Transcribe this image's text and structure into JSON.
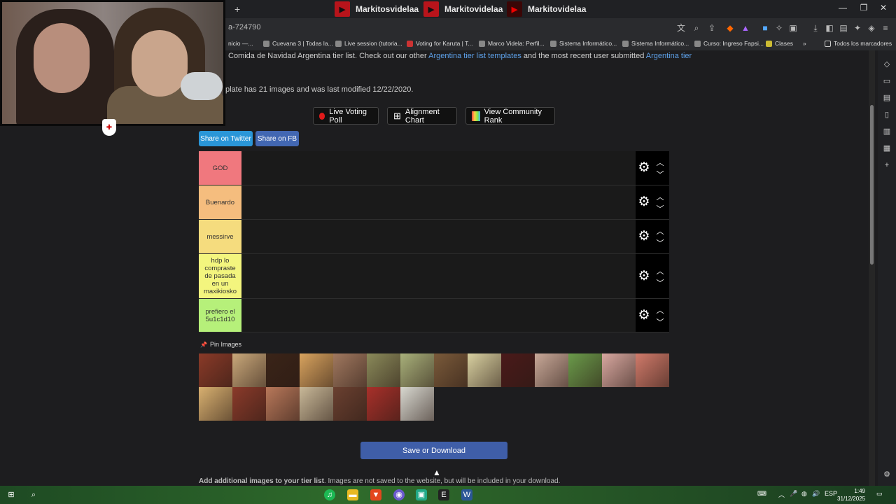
{
  "browser": {
    "tabs": [
      {
        "label": "Markitosvidelaa",
        "icon": "youtube-icon"
      },
      {
        "label": "Markitovidelaa",
        "icon": "youtube-icon"
      },
      {
        "label": "Markitovidelaa",
        "icon": "youtube-icon"
      }
    ],
    "new_tab_label": "+",
    "url": "a-724790",
    "bookmarks": [
      {
        "label": "nicio —..."
      },
      {
        "label": "Cuevana 3 | Todas la..."
      },
      {
        "label": "Live session (tutoria..."
      },
      {
        "label": "Voting for Karuta | T..."
      },
      {
        "label": "Marco Videla: Perfil..."
      },
      {
        "label": "Sistema Informático..."
      },
      {
        "label": "Sistema Informático..."
      },
      {
        "label": "Curso: Ingreso Fapsi..."
      },
      {
        "label": "Clases"
      }
    ],
    "bookmarks_more": "»",
    "all_bookmarks": "Todos los marcadores"
  },
  "page": {
    "intro_prefix": "Comida de Navidad Argentina tier list. Check out our other ",
    "intro_link1": "Argentina tier list templates",
    "intro_mid": " and the most recent user submitted ",
    "intro_link2": "Argentina tier",
    "template_info": "plate has 21 images and was last modified 12/22/2020.",
    "buttons": {
      "live_poll": "Live Voting Poll",
      "alignment": "Alignment Chart",
      "community": "View Community Rank"
    },
    "share_twitter": "Share on Twitter",
    "share_fb": "Share on FB",
    "tiers": [
      {
        "label": "GOD",
        "color": "#f0787e"
      },
      {
        "label": "Buenardo",
        "color": "#f5bd7e"
      },
      {
        "label": "messirve",
        "color": "#f5dc7e"
      },
      {
        "label": "hdp lo compraste de pasada en un maxikiosko",
        "color": "#f3f57e"
      },
      {
        "label": "prefiero el 5u1c1d10",
        "color": "#b6f07a"
      }
    ],
    "pin_label": "Pin Images",
    "images": [
      {
        "color": "#8a3a28"
      },
      {
        "color": "#c9a87a"
      },
      {
        "color": "#3a2418"
      },
      {
        "color": "#d8a35e"
      },
      {
        "color": "#a0785f"
      },
      {
        "color": "#8a8a5a"
      },
      {
        "color": "#a8b07a"
      },
      {
        "color": "#7a5a3a"
      },
      {
        "color": "#d8d0a0"
      },
      {
        "color": "#4a1a1a"
      },
      {
        "color": "#c8a898"
      },
      {
        "color": "#6a9a4a"
      },
      {
        "color": "#d8a8a0"
      },
      {
        "color": "#d07a6a"
      },
      {
        "color": "#d8b070"
      },
      {
        "color": "#8a3a2a"
      },
      {
        "color": "#b8785a"
      },
      {
        "color": "#c8b898"
      },
      {
        "color": "#6a4030"
      },
      {
        "color": "#a8302a"
      },
      {
        "color": "#d8d8d0"
      }
    ],
    "save_button": "Save or Download",
    "add_bold": "Add additional images to your tier list",
    "add_rest": ". Images are not saved to the website, but will be included in your download."
  },
  "taskbar": {
    "lang": "ESP",
    "time": "1:49",
    "date": "31/12/2025"
  }
}
